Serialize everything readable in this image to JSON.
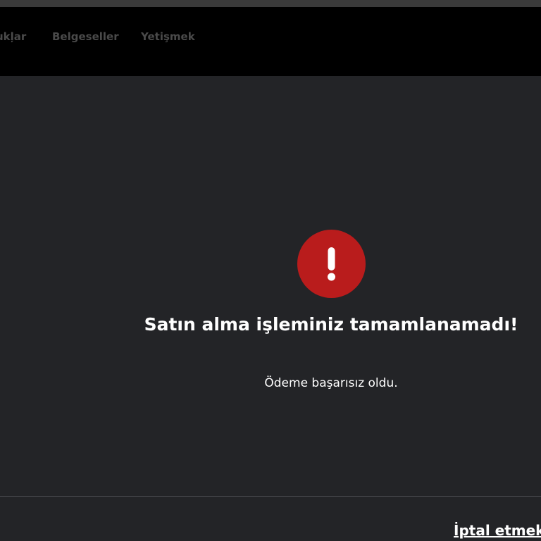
{
  "nav": {
    "items": [
      {
        "label": "ukļar"
      },
      {
        "label": "Belgeseller"
      },
      {
        "label": "Yetişmek"
      }
    ]
  },
  "error": {
    "icon": "exclamation-icon",
    "color": "#b91c1c",
    "title": "Satın alma işleminiz tamamlanamadı!",
    "message": "Ödeme başarısız oldu."
  },
  "footer": {
    "cancel_label": "İptal etmek"
  }
}
